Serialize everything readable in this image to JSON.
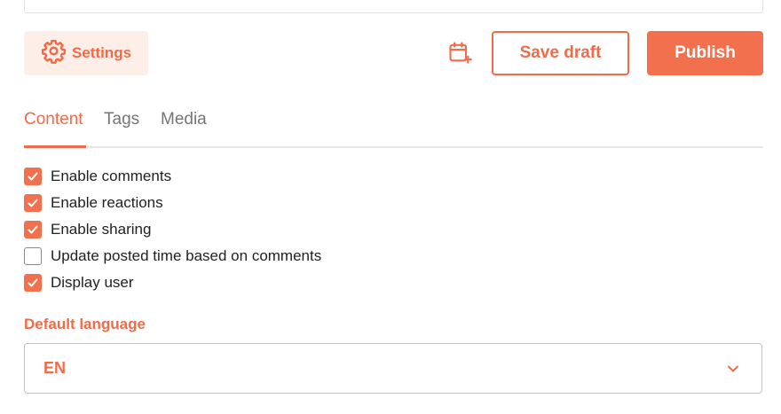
{
  "toolbar": {
    "settings_label": "Settings",
    "settings_icon": "gear-icon",
    "schedule_icon": "calendar-plus-icon",
    "save_draft_label": "Save draft",
    "publish_label": "Publish"
  },
  "tabs": [
    {
      "label": "Content",
      "active": true
    },
    {
      "label": "Tags",
      "active": false
    },
    {
      "label": "Media",
      "active": false
    }
  ],
  "options": [
    {
      "label": "Enable comments",
      "checked": true
    },
    {
      "label": "Enable reactions",
      "checked": true
    },
    {
      "label": "Enable sharing",
      "checked": true
    },
    {
      "label": "Update posted time based on comments",
      "checked": false
    },
    {
      "label": "Display user",
      "checked": true
    }
  ],
  "default_language": {
    "label": "Default language",
    "value": "EN"
  },
  "colors": {
    "accent": "#f06b49",
    "accent_light": "#fdeee8",
    "text": "#212121",
    "muted": "#757575"
  }
}
